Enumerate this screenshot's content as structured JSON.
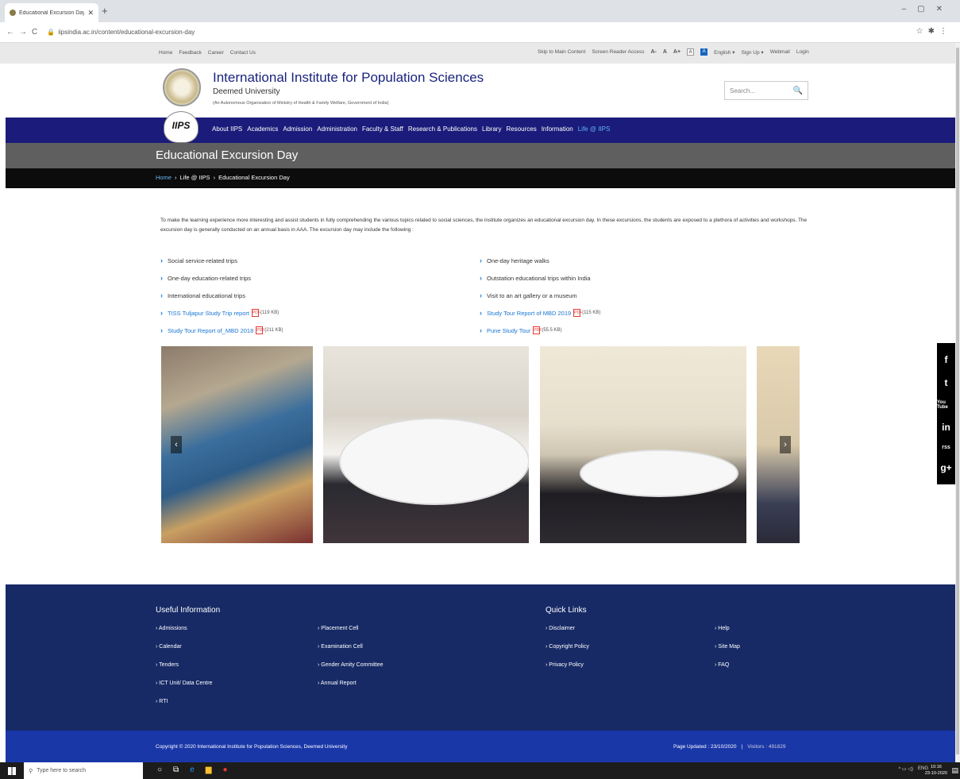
{
  "browser": {
    "tab_title": "Educational Excursion Day | Inte…",
    "url": "iipsindia.ac.in/content/educational-excursion-day"
  },
  "util": {
    "left": [
      "Home",
      "Feedback",
      "Career",
      "Contact Us"
    ],
    "skip": "Skip to Main Content",
    "reader": "Screen Reader Access",
    "font_small": "A-",
    "font_normal": "A",
    "font_large": "A+",
    "contrast_a": "A",
    "contrast_b": "A",
    "lang": "English",
    "signup": "Sign Up",
    "webmail": "Webmail",
    "login": "Login"
  },
  "header": {
    "title": "International Institute for Population Sciences",
    "subtitle": "Deemed University",
    "tagline": "(An Autonomous Organization of Ministry of Health & Family Welfare, Government of India)",
    "search_placeholder": "Search...",
    "logo_text": "IIPS"
  },
  "nav": [
    "About IIPS",
    "Academics",
    "Admission",
    "Administration",
    "Faculty & Staff",
    "Research & Publications",
    "Library",
    "Resources",
    "Information",
    "Life @ IIPS"
  ],
  "page": {
    "title": "Educational Excursion Day",
    "breadcrumb": [
      "Home",
      "›",
      "Life @ IIPS",
      "›",
      "Educational Excursion Day"
    ],
    "intro": "To make the learning experience more interesting and assist students in fully comprehending the various topics related to social sciences, the institute organizes an educational excursion day. In these excursions, the students are exposed to a plethora of activities and workshops. The excursion day is generally conducted on an annual basis in AAA. The excursion day may include the following :"
  },
  "list_left": [
    {
      "label": "Social service-related trips"
    },
    {
      "label": "One-day education-related trips"
    },
    {
      "label": "International educational trips"
    },
    {
      "label": "TISS Tuljapur Study Trip report",
      "size": "(119 KB)"
    },
    {
      "label": "Study Tour Report of_MBD 2018",
      "size": "(211 KB)"
    }
  ],
  "list_right": [
    {
      "label": "One-day heritage walks"
    },
    {
      "label": "Outstation educational trips within India"
    },
    {
      "label": "Visit to an art gallery or a museum"
    },
    {
      "label": "Study Tour Report of MBD 2019",
      "size": "(115 KB)"
    },
    {
      "label": "Pune Study Tour",
      "size": "(55.5 KB)"
    }
  ],
  "footer": {
    "useful_title": "Useful Information",
    "useful_col1": [
      "Admissions",
      "Calendar",
      "Tenders",
      "ICT Unit/ Data Centre",
      "RTI"
    ],
    "useful_col2": [
      "Placement Cell",
      "Examination Cell",
      "Gender Amity Committee",
      "Annual Report"
    ],
    "quick_title": "Quick Links",
    "quick_col1": [
      "Disclaimer",
      "Copyright Policy",
      "Privacy Policy"
    ],
    "quick_col2": [
      "Help",
      "Site Map",
      "FAQ"
    ],
    "copyright": "Copyright © 2020 International Institute for Population Sciences, Deemed University",
    "page_updated": "Page Updated : 23/10/2020",
    "sep": "|",
    "visitors": "Visitors : 491829"
  },
  "taskbar": {
    "search": "Type here to search",
    "lang": "ENG",
    "time": "10:16",
    "date": "23-10-2020"
  },
  "social": [
    "f",
    "t",
    "You Tube",
    "in",
    "rss",
    "g+"
  ],
  "colors": {
    "nav": "#1a1b7a",
    "footer": "#172a66",
    "copybar": "#1a37a8",
    "link": "#1976d2"
  }
}
